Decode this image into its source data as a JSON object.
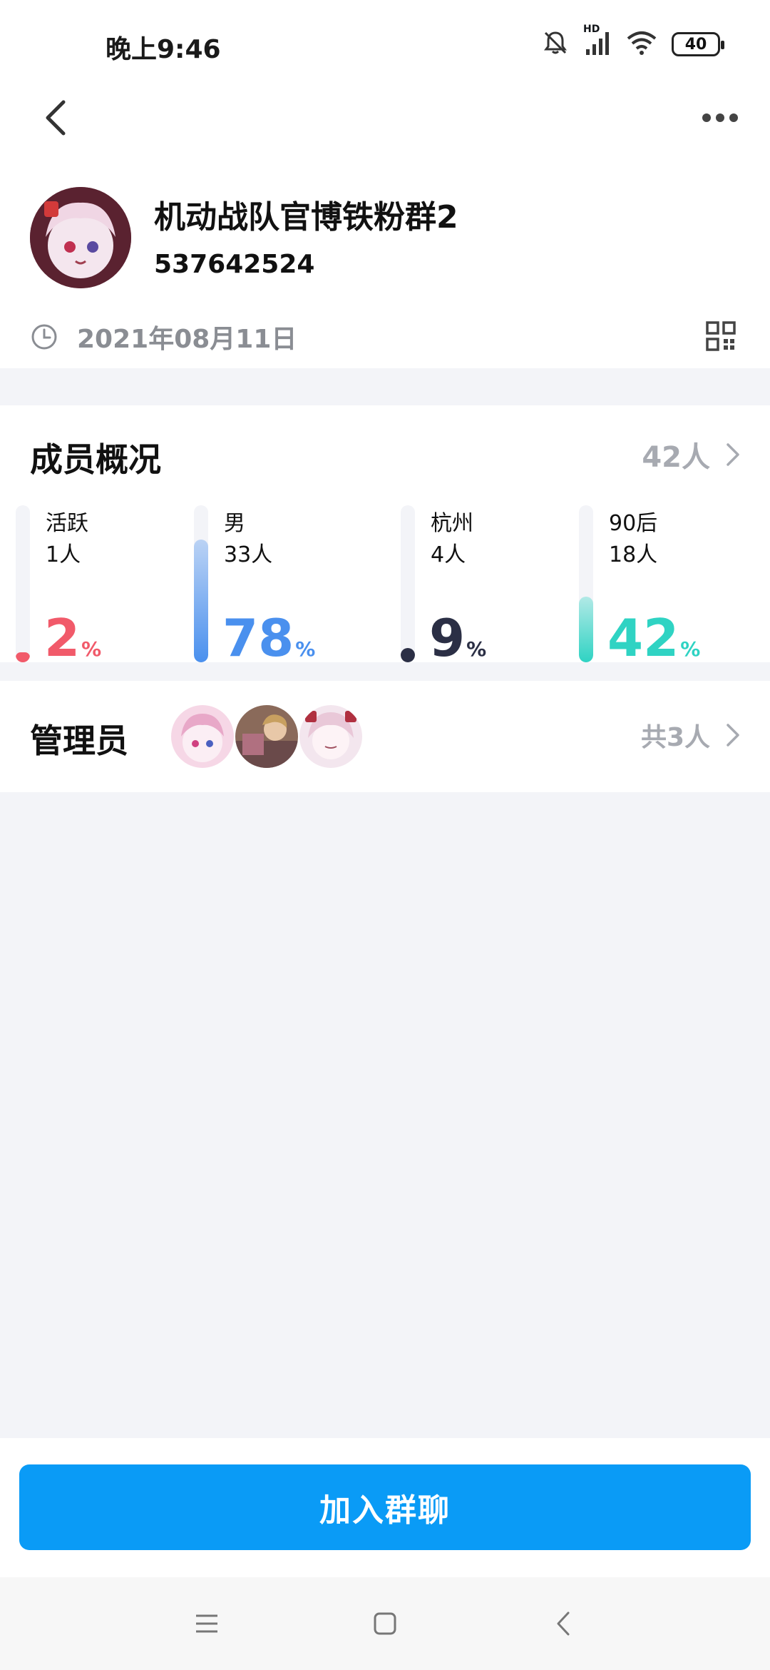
{
  "status_bar": {
    "time": "晚上9:46",
    "battery": "40",
    "signal_label": "HD"
  },
  "group": {
    "name": "机动战队官博铁粉群2",
    "id": "537642524",
    "created_date": "2021年08月11日"
  },
  "members": {
    "title": "成员概况",
    "total": "42人",
    "stats": [
      {
        "label": "活跃",
        "count": "1人",
        "percent": "2",
        "fill": 0.02,
        "color": "#f15a6a",
        "sign": "%"
      },
      {
        "label": "男",
        "count": "33人",
        "percent": "78",
        "fill": 0.78,
        "color": "#4a90ee",
        "sign": "%"
      },
      {
        "label": "杭州",
        "count": "4人",
        "percent": "9",
        "fill": 0.09,
        "color": "#2b2f45",
        "sign": "%"
      },
      {
        "label": "90后",
        "count": "18人",
        "percent": "42",
        "fill": 0.42,
        "color": "#2fd3c3",
        "sign": "%"
      }
    ]
  },
  "admins": {
    "title": "管理员",
    "count": "共3人"
  },
  "join_button": "加入群聊",
  "colors": {
    "accent": "#0a9bf6",
    "page_bg": "#f3f4f8",
    "muted_text": "#a7aab1"
  }
}
